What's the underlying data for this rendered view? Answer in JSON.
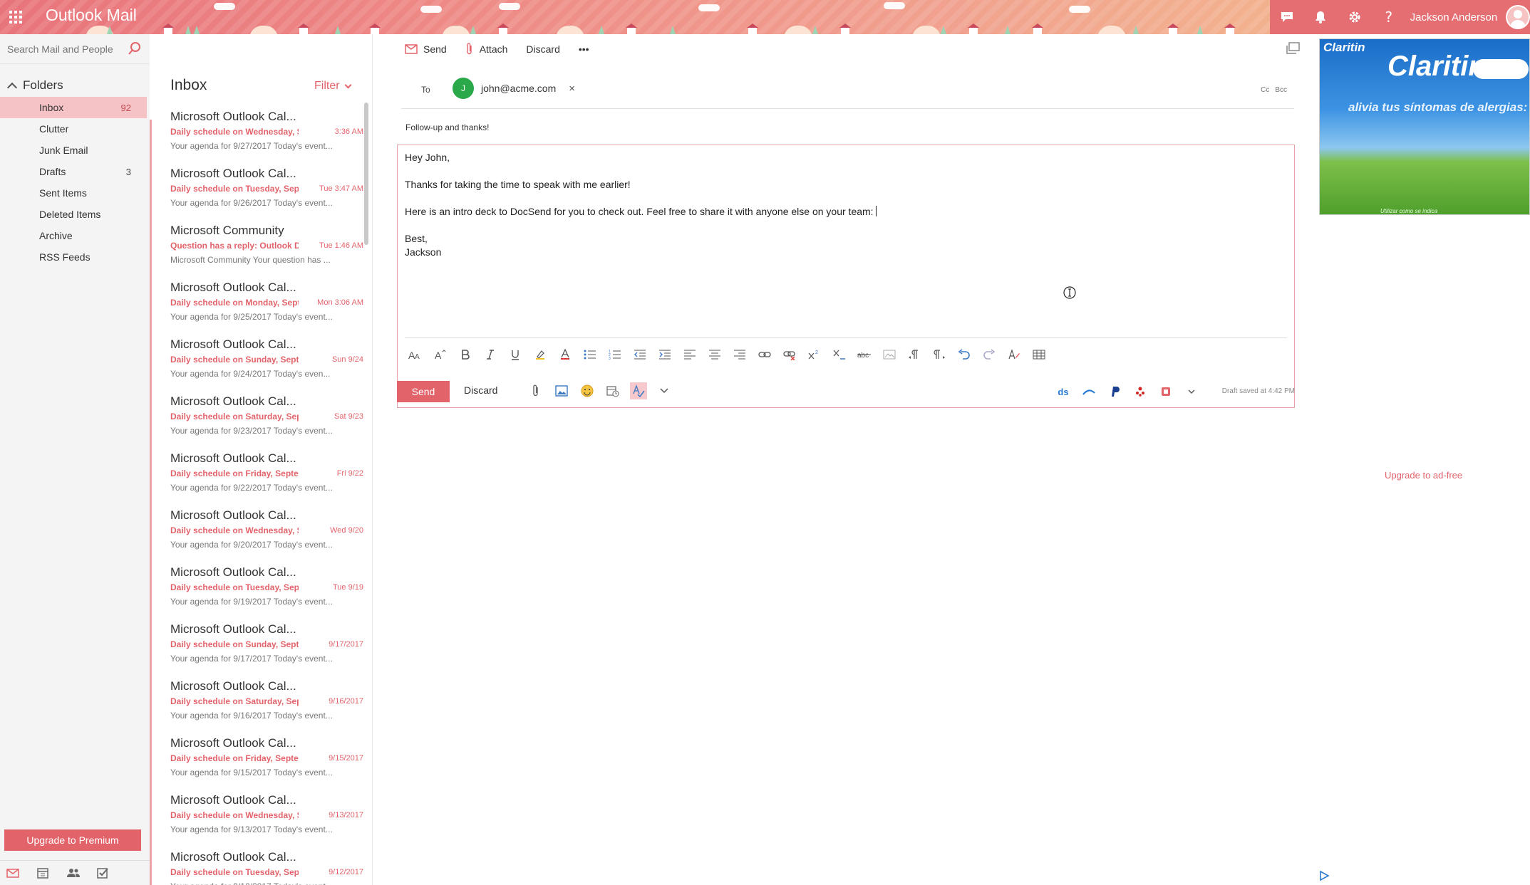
{
  "header": {
    "app_title": "Outlook Mail",
    "user_name": "Jackson Anderson",
    "icons": [
      "chat-icon",
      "bell-icon",
      "gear-icon",
      "help-icon"
    ]
  },
  "search": {
    "placeholder": "Search Mail and People"
  },
  "folders": {
    "title": "Folders",
    "items": [
      {
        "label": "Inbox",
        "count": "92",
        "active": true
      },
      {
        "label": "Clutter",
        "count": ""
      },
      {
        "label": "Junk Email",
        "count": ""
      },
      {
        "label": "Drafts",
        "count": "3"
      },
      {
        "label": "Sent Items",
        "count": ""
      },
      {
        "label": "Deleted Items",
        "count": ""
      },
      {
        "label": "Archive",
        "count": ""
      },
      {
        "label": "RSS Feeds",
        "count": ""
      }
    ],
    "upgrade_label": "Upgrade to Premium"
  },
  "inbox": {
    "title": "Inbox",
    "filter_label": "Filter",
    "messages": [
      {
        "sender": "Microsoft Outlook Cal...",
        "subject": "Daily schedule on Wednesday, Se",
        "time": "3:36 AM",
        "preview": "Your agenda for 9/27/2017  Today's event..."
      },
      {
        "sender": "Microsoft Outlook Cal...",
        "subject": "Daily schedule on Tuesday, Septe",
        "time": "Tue 3:47 AM",
        "preview": "Your agenda for 9/26/2017  Today's event..."
      },
      {
        "sender": "Microsoft Community",
        "subject": "Question has a reply: Outlook De",
        "time": "Tue 1:46 AM",
        "preview": "Microsoft Community Your question has ..."
      },
      {
        "sender": "Microsoft Outlook Cal...",
        "subject": "Daily schedule on Monday, Septe",
        "time": "Mon 3:06 AM",
        "preview": "Your agenda for 9/25/2017  Today's event..."
      },
      {
        "sender": "Microsoft Outlook Cal...",
        "subject": "Daily schedule on Sunday, Septe",
        "time": "Sun 9/24",
        "preview": "Your agenda for 9/24/2017  Today's even..."
      },
      {
        "sender": "Microsoft Outlook Cal...",
        "subject": "Daily schedule on Saturday, Sept",
        "time": "Sat 9/23",
        "preview": "Your agenda for 9/23/2017  Today's event..."
      },
      {
        "sender": "Microsoft Outlook Cal...",
        "subject": "Daily schedule on Friday, Septem",
        "time": "Fri 9/22",
        "preview": "Your agenda for 9/22/2017  Today's event..."
      },
      {
        "sender": "Microsoft Outlook Cal...",
        "subject": "Daily schedule on Wednesday, Se",
        "time": "Wed 9/20",
        "preview": "Your agenda for 9/20/2017  Today's event..."
      },
      {
        "sender": "Microsoft Outlook Cal...",
        "subject": "Daily schedule on Tuesday, Septe",
        "time": "Tue 9/19",
        "preview": "Your agenda for 9/19/2017  Today's event..."
      },
      {
        "sender": "Microsoft Outlook Cal...",
        "subject": "Daily schedule on Sunday, Septe",
        "time": "9/17/2017",
        "preview": "Your agenda for 9/17/2017  Today's event..."
      },
      {
        "sender": "Microsoft Outlook Cal...",
        "subject": "Daily schedule on Saturday, Sept",
        "time": "9/16/2017",
        "preview": "Your agenda for 9/16/2017  Today's event..."
      },
      {
        "sender": "Microsoft Outlook Cal...",
        "subject": "Daily schedule on Friday, Septem",
        "time": "9/15/2017",
        "preview": "Your agenda for 9/15/2017  Today's event..."
      },
      {
        "sender": "Microsoft Outlook Cal...",
        "subject": "Daily schedule on Wednesday, Se",
        "time": "9/13/2017",
        "preview": "Your agenda for 9/13/2017  Today's event..."
      },
      {
        "sender": "Microsoft Outlook Cal...",
        "subject": "Daily schedule on Tuesday, Septe",
        "time": "9/12/2017",
        "preview": "Your agenda for 9/12/2017  Today's event..."
      }
    ]
  },
  "compose": {
    "toolbar": {
      "send": "Send",
      "attach": "Attach",
      "discard": "Discard",
      "more": "•••"
    },
    "to_label": "To",
    "recipient": {
      "initial": "J",
      "email": "john@acme.com",
      "remove": "×"
    },
    "cc": "Cc",
    "bcc": "Bcc",
    "subject": "Follow-up and thanks!",
    "body": {
      "greeting": "Hey John,",
      "line1": "Thanks for taking the time to speak with me earlier!",
      "line2": "Here is an intro deck to DocSend for you to check out. Feel free to share it with anyone else on your team:",
      "signoff": "Best,",
      "name": "Jackson"
    },
    "send_label": "Send",
    "discard_label": "Discard",
    "draft_status": "Draft saved at 4:42 PM",
    "addin_ds": "ds"
  },
  "ad": {
    "brand_small": "Claritin",
    "brand_large": "Claritin",
    "tagline": "alivia tus síntomas de alergias:",
    "disclaimer": "Utilizar como se indica",
    "upgrade_label": "Upgrade to ad-free"
  },
  "colors": {
    "accent": "#e3636b",
    "active_folder": "#f5c3c5",
    "header_right": "#e46e72",
    "avatar_green": "#2aa84a"
  }
}
